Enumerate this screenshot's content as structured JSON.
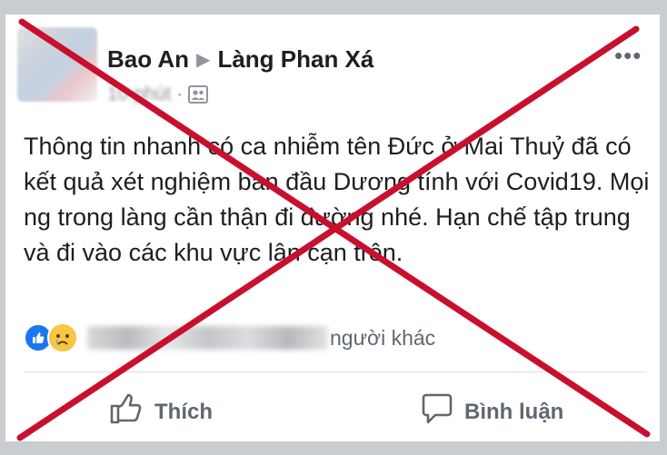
{
  "post": {
    "author": "Bao An",
    "group": "Làng Phan Xá",
    "time": "10 phút",
    "more_label": "•••",
    "text": "Thông tin nhanh có ca nhiễm tên Đức ở Mai Thuỷ đã có kết quả xét nghiệm ban đầu Dương tính với Covid19. Mọi ng trong làng cần thận đi đường nhé. Hạn chế tập trung và đi vào các khu vực lân cạn trên.",
    "reactions": {
      "icons": [
        "like-icon",
        "sad-icon"
      ],
      "others_text": "người khác"
    },
    "actions": {
      "like_label": "Thích",
      "comment_label": "Bình luận"
    }
  },
  "overlay": {
    "cross_color": "#c8102e"
  },
  "colors": {
    "fb_blue": "#1877f2",
    "text": "#1c1e21",
    "secondary": "#606770"
  }
}
